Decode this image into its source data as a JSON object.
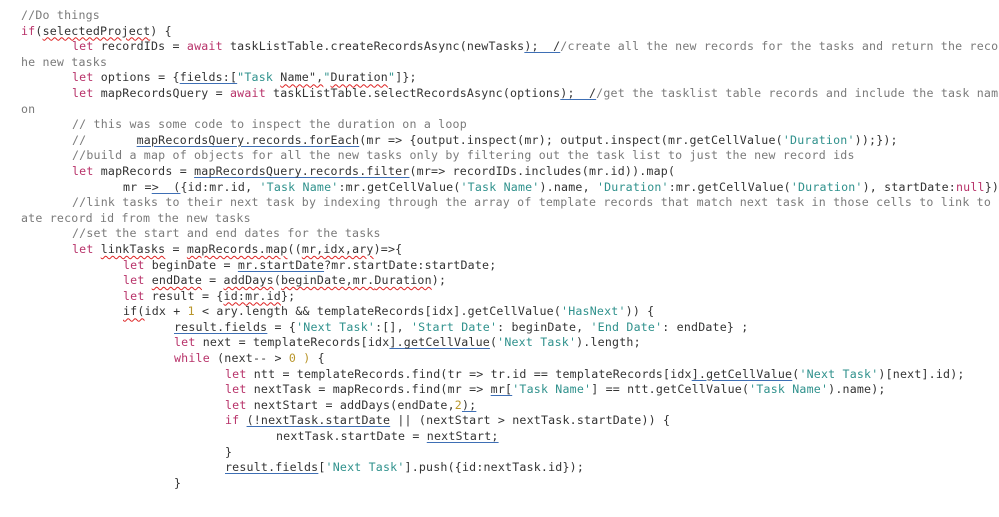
{
  "editor": {
    "lines": [
      {
        "indent": 0,
        "tokens": [
          {
            "t": "cm",
            "v": "//Do things"
          }
        ]
      },
      {
        "indent": 0,
        "tokens": [
          {
            "t": "kw",
            "v": "if"
          },
          {
            "t": "p",
            "v": "("
          },
          {
            "t": "sq",
            "v": "selectedProject"
          },
          {
            "t": "p",
            "v": ") {"
          }
        ]
      },
      {
        "indent": 1,
        "tokens": [
          {
            "t": "kw",
            "v": "let"
          },
          {
            "t": "p",
            "v": " recordIDs = "
          },
          {
            "t": "kw",
            "v": "await"
          },
          {
            "t": "p",
            "v": " taskListTable.createRecordsAsync(newTasks"
          },
          {
            "t": "bu",
            "v": ");  /"
          },
          {
            "t": "cm",
            "v": "/create all the new records for the tasks and return the record ids for t"
          }
        ]
      },
      {
        "indent": 0,
        "tokens": [
          {
            "t": "cm",
            "v": "he new tasks"
          }
        ]
      },
      {
        "indent": 1,
        "tokens": [
          {
            "t": "kw",
            "v": "let"
          },
          {
            "t": "p",
            "v": " options = {"
          },
          {
            "t": "bu",
            "v": "fields:["
          },
          {
            "t": "str",
            "v": "\"Task "
          },
          {
            "t": "sq",
            "v": "Name\","
          },
          {
            "t": "str",
            "v": "\""
          },
          {
            "t": "sq",
            "v": "Duration"
          },
          {
            "t": "str",
            "v": "\""
          },
          {
            "t": "p",
            "v": "]};"
          }
        ]
      },
      {
        "indent": 1,
        "tokens": [
          {
            "t": "kw",
            "v": "let"
          },
          {
            "t": "p",
            "v": " mapRecordsQuery = "
          },
          {
            "t": "kw",
            "v": "await"
          },
          {
            "t": "p",
            "v": " taskListTable.selectRecordsAsync(options"
          },
          {
            "t": "bu",
            "v": ");  /"
          },
          {
            "t": "cm",
            "v": "/get the tasklist table records and include the task name and durati"
          }
        ]
      },
      {
        "indent": 0,
        "tokens": [
          {
            "t": "cm",
            "v": "on"
          }
        ]
      },
      {
        "indent": 1,
        "tokens": [
          {
            "t": "cm",
            "v": "// this was some code to inspect the duration on a loop"
          }
        ]
      },
      {
        "indent": 1,
        "tokens": [
          {
            "t": "cm",
            "v": "//       "
          },
          {
            "t": "bu",
            "v": "mapRecordsQuery.records.forEach"
          },
          {
            "t": "p",
            "v": "(mr => {output.inspect(mr); output.inspect(mr.getCellValue("
          },
          {
            "t": "str",
            "v": "'Duration'"
          },
          {
            "t": "p",
            "v": "));});"
          }
        ]
      },
      {
        "indent": 1,
        "tokens": [
          {
            "t": "cm",
            "v": "//build a map of objects for all the new tasks only by filtering out the task list to just the new record ids"
          }
        ]
      },
      {
        "indent": 1,
        "tokens": [
          {
            "t": "kw",
            "v": "let"
          },
          {
            "t": "p",
            "v": " mapRecords = "
          },
          {
            "t": "bu",
            "v": "mapRecordsQuery.records.filter"
          },
          {
            "t": "p",
            "v": "(mr=> recordIDs.includes(mr.id)).map("
          }
        ]
      },
      {
        "indent": 2,
        "tokens": [
          {
            "t": "p",
            "v": "mr ="
          },
          {
            "t": "bu",
            "v": ">  ("
          },
          {
            "t": "p",
            "v": "{id:mr.id, "
          },
          {
            "t": "str",
            "v": "'Task Name'"
          },
          {
            "t": "p",
            "v": ":mr.getCellValue("
          },
          {
            "t": "str",
            "v": "'Task Name'"
          },
          {
            "t": "p",
            "v": ").name, "
          },
          {
            "t": "str",
            "v": "'Duration'"
          },
          {
            "t": "p",
            "v": ":mr.getCellValue("
          },
          {
            "t": "str",
            "v": "'Duration'"
          },
          {
            "t": "p",
            "v": "), startDate:"
          },
          {
            "t": "kw",
            "v": "null"
          },
          {
            "t": "p",
            "v": "}));"
          }
        ]
      },
      {
        "indent": 1,
        "tokens": [
          {
            "t": "cm",
            "v": "//link tasks to their next task by indexing through the array of template records that match next task in those cells to link to the appropri"
          }
        ]
      },
      {
        "indent": 0,
        "tokens": [
          {
            "t": "cm",
            "v": "ate record id from the new tasks"
          }
        ]
      },
      {
        "indent": 1,
        "tokens": [
          {
            "t": "cm",
            "v": "//set the start and end dates for the tasks"
          }
        ]
      },
      {
        "indent": 1,
        "tokens": [
          {
            "t": "kw",
            "v": "let"
          },
          {
            "t": "p",
            "v": " "
          },
          {
            "t": "sq",
            "v": "linkTasks"
          },
          {
            "t": "p",
            "v": " = "
          },
          {
            "t": "sq",
            "v": "mapRecords.map"
          },
          {
            "t": "p",
            "v": "(("
          },
          {
            "t": "sq",
            "v": "mr,idx,ary"
          },
          {
            "t": "p",
            "v": ")=>{"
          }
        ]
      },
      {
        "indent": 2,
        "tokens": [
          {
            "t": "kw",
            "v": "let"
          },
          {
            "t": "p",
            "v": " beginDate = "
          },
          {
            "t": "bu",
            "v": "mr.startDate"
          },
          {
            "t": "p",
            "v": "?mr.startDate:startDate;"
          }
        ]
      },
      {
        "indent": 2,
        "tokens": [
          {
            "t": "kw",
            "v": "let"
          },
          {
            "t": "p",
            "v": " "
          },
          {
            "t": "sq",
            "v": "endDate"
          },
          {
            "t": "p",
            "v": " = "
          },
          {
            "t": "sq",
            "v": "addDays"
          },
          {
            "t": "p",
            "v": "("
          },
          {
            "t": "sq",
            "v": "beginDate,mr."
          },
          {
            "t": "sq",
            "v": "Duration"
          },
          {
            "t": "p",
            "v": ");"
          }
        ]
      },
      {
        "indent": 2,
        "tokens": [
          {
            "t": "kw",
            "v": "let"
          },
          {
            "t": "p",
            "v": " result = {"
          },
          {
            "t": "sq",
            "v": "id:mr.id"
          },
          {
            "t": "p",
            "v": "};"
          }
        ]
      },
      {
        "indent": 2,
        "tokens": [
          {
            "t": "sq",
            "v": "if("
          },
          {
            "t": "p",
            "v": "idx + "
          },
          {
            "t": "num",
            "v": "1"
          },
          {
            "t": "p",
            "v": " < ary.length && templateRecords[idx].getCellValue("
          },
          {
            "t": "str",
            "v": "'HasNext'"
          },
          {
            "t": "p",
            "v": ")) {"
          }
        ]
      },
      {
        "indent": 3,
        "tokens": [
          {
            "t": "bu",
            "v": "result.fields"
          },
          {
            "t": "p",
            "v": " = {"
          },
          {
            "t": "str",
            "v": "'Next Task'"
          },
          {
            "t": "p",
            "v": ":[], "
          },
          {
            "t": "str",
            "v": "'Start Date'"
          },
          {
            "t": "p",
            "v": ": beginDate, "
          },
          {
            "t": "str",
            "v": "'End Date'"
          },
          {
            "t": "p",
            "v": ": endDate} ;"
          }
        ]
      },
      {
        "indent": 3,
        "tokens": [
          {
            "t": "kw",
            "v": "let"
          },
          {
            "t": "p",
            "v": " next = templateRecords[idx"
          },
          {
            "t": "bu",
            "v": "].getCellValue"
          },
          {
            "t": "p",
            "v": "("
          },
          {
            "t": "str",
            "v": "'Next Task'"
          },
          {
            "t": "p",
            "v": ").length;"
          }
        ]
      },
      {
        "indent": 3,
        "tokens": [
          {
            "t": "kw",
            "v": "while"
          },
          {
            "t": "p",
            "v": " (next-- > "
          },
          {
            "t": "num",
            "v": "0 )"
          },
          {
            "t": "p",
            "v": " {"
          }
        ]
      },
      {
        "indent": 4,
        "tokens": [
          {
            "t": "kw",
            "v": "let"
          },
          {
            "t": "p",
            "v": " ntt = templateRecords.find(tr => tr.id == templateRecords[idx"
          },
          {
            "t": "bu",
            "v": "].getCellValue"
          },
          {
            "t": "p",
            "v": "("
          },
          {
            "t": "str",
            "v": "'Next Task'"
          },
          {
            "t": "p",
            "v": ")[next].id);"
          }
        ]
      },
      {
        "indent": 4,
        "tokens": [
          {
            "t": "kw",
            "v": "let"
          },
          {
            "t": "p",
            "v": " nextTask = mapRecords.find(mr => "
          },
          {
            "t": "bu",
            "v": "mr["
          },
          {
            "t": "str",
            "v": "'Task Name'"
          },
          {
            "t": "p",
            "v": "] == ntt.getCellValue("
          },
          {
            "t": "str",
            "v": "'Task Name'"
          },
          {
            "t": "p",
            "v": ").name);"
          }
        ]
      },
      {
        "indent": 4,
        "tokens": [
          {
            "t": "kw",
            "v": "let"
          },
          {
            "t": "p",
            "v": " nextStart = addDays(endDate,"
          },
          {
            "t": "num",
            "v": "2"
          },
          {
            "t": "bu",
            "v": ");"
          }
        ]
      },
      {
        "indent": 4,
        "tokens": [
          {
            "t": "kw",
            "v": "if"
          },
          {
            "t": "p",
            "v": " "
          },
          {
            "t": "bu",
            "v": "(!nextTask.startDate"
          },
          {
            "t": "p",
            "v": " || (nextStart > nextTask.startDate)) {"
          }
        ]
      },
      {
        "indent": 5,
        "tokens": [
          {
            "t": "p",
            "v": "nextTask.startDate = "
          },
          {
            "t": "bu",
            "v": "nextStart;"
          }
        ]
      },
      {
        "indent": 4,
        "tokens": [
          {
            "t": "p",
            "v": "}"
          }
        ]
      },
      {
        "indent": 4,
        "tokens": [
          {
            "t": "bu",
            "v": "result.fields"
          },
          {
            "t": "p",
            "v": "["
          },
          {
            "t": "str",
            "v": "'Next Task'"
          },
          {
            "t": "p",
            "v": "].push({id:nextTask.id});"
          }
        ]
      },
      {
        "indent": 3,
        "tokens": [
          {
            "t": "p",
            "v": "}"
          }
        ]
      }
    ]
  }
}
